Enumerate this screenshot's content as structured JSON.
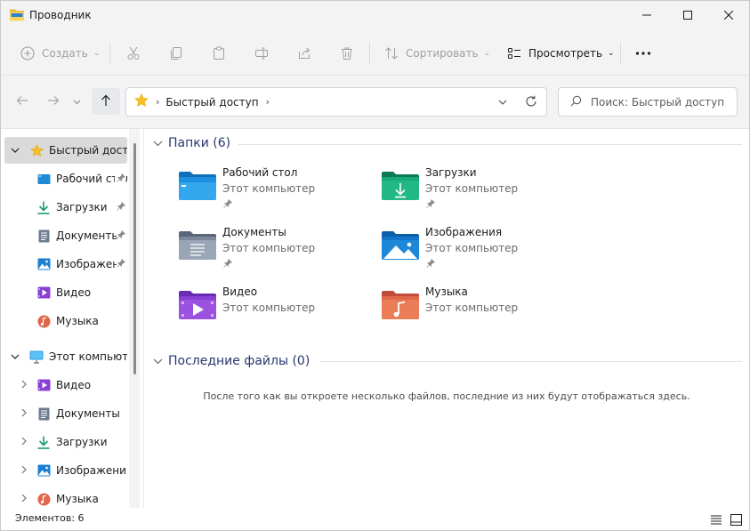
{
  "window": {
    "title": "Проводник"
  },
  "command_bar": {
    "new_label": "Создать",
    "sort_label": "Сортировать",
    "view_label": "Просмотреть"
  },
  "address_bar": {
    "location": "Быстрый доступ",
    "search_placeholder": "Поиск: Быстрый доступ"
  },
  "sidebar": {
    "quick_access": {
      "label": "Быстрый доступ"
    },
    "quick_access_items": [
      {
        "label": "Рабочий стол",
        "icon": "desktop-icon",
        "pinned": true
      },
      {
        "label": "Загрузки",
        "icon": "download-icon",
        "pinned": true
      },
      {
        "label": "Документы",
        "icon": "document-icon",
        "pinned": true
      },
      {
        "label": "Изображения",
        "icon": "pictures-icon",
        "pinned": true
      },
      {
        "label": "Видео",
        "icon": "video-icon",
        "pinned": false
      },
      {
        "label": "Музыка",
        "icon": "music-icon",
        "pinned": false
      }
    ],
    "this_pc": {
      "label": "Этот компьютер"
    },
    "this_pc_items": [
      {
        "label": "Видео",
        "icon": "video-icon"
      },
      {
        "label": "Документы",
        "icon": "document-icon"
      },
      {
        "label": "Загрузки",
        "icon": "download-icon"
      },
      {
        "label": "Изображения",
        "icon": "pictures-icon"
      },
      {
        "label": "Музыка",
        "icon": "music-icon"
      }
    ]
  },
  "main": {
    "folders_header": "Папки (6)",
    "folders": [
      {
        "name": "Рабочий стол",
        "location": "Этот компьютер",
        "pinned": true,
        "icon": "desktop-folder-icon"
      },
      {
        "name": "Загрузки",
        "location": "Этот компьютер",
        "pinned": true,
        "icon": "downloads-folder-icon"
      },
      {
        "name": "Документы",
        "location": "Этот компьютер",
        "pinned": true,
        "icon": "documents-folder-icon"
      },
      {
        "name": "Изображения",
        "location": "Этот компьютер",
        "pinned": true,
        "icon": "pictures-folder-icon"
      },
      {
        "name": "Видео",
        "location": "Этот компьютер",
        "pinned": false,
        "icon": "videos-folder-icon"
      },
      {
        "name": "Музыка",
        "location": "Этот компьютер",
        "pinned": false,
        "icon": "music-folder-icon"
      }
    ],
    "recent_header": "Последние файлы (0)",
    "recent_empty_message": "После того как вы откроете несколько файлов, последние из них будут отображаться здесь."
  },
  "status_bar": {
    "items_count": "Элементов: 6"
  },
  "colors": {
    "chrome_bg": "#f3f3f3",
    "section_header": "#28366d",
    "selected_bg": "#dadada",
    "accent_blue": "#0078d4"
  }
}
